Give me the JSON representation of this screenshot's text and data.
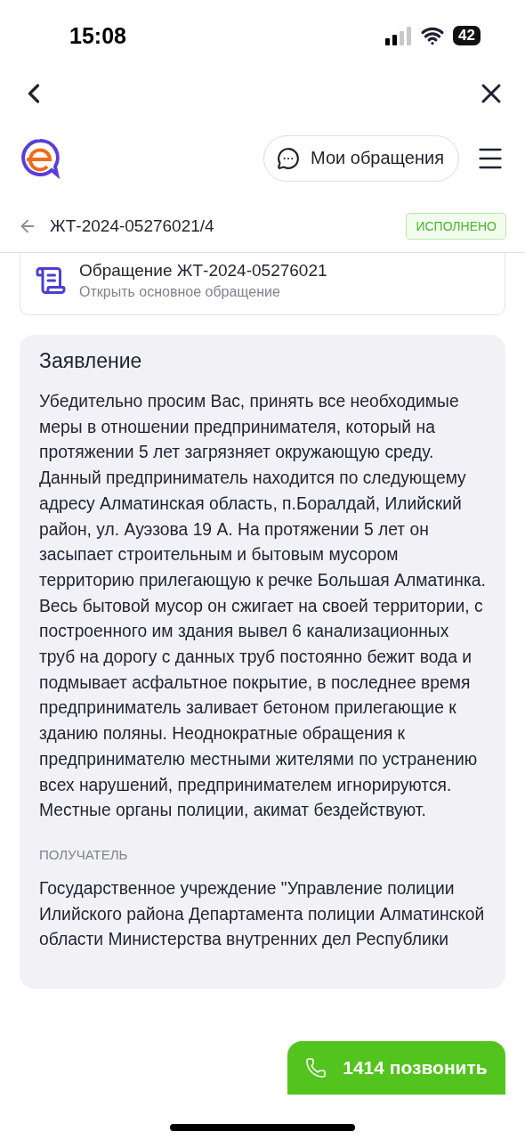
{
  "status_bar": {
    "time": "15:08",
    "battery": "42"
  },
  "header": {
    "my_requests": "Мои обращения"
  },
  "title_row": {
    "number": "ЖТ-2024-05276021/4",
    "status": "ИСПОЛНЕНО"
  },
  "parent_link": {
    "title": "Обращение ЖТ-2024-05276021",
    "subtitle": "Открыть основное обращение"
  },
  "statement": {
    "title": "Заявление",
    "text": "Убедительно просим Вас, принять все необходимые меры в отношении предпринимателя, который на протяжении 5 лет загрязняет окружающую среду. Данный предприниматель находится по следующему адресу Алматинская область, п.Боралдай, Илийский район, ул. Ауэзова 19 А. На протяжении 5 лет он засыпает строительным и бытовым мусором территорию прилегающую к речке Большая Алматинка. Весь бытовой мусор он сжигает на своей территории, с построенного им здания вывел 6 канализационных труб на дорогу с данных труб постоянно бежит вода и подмывает асфальтное покрытие, в последнее время предприниматель заливает бетоном прилегающие к зданию поляны. Неоднократные обращения к предпринимателю местными жителями по устранению всех нарушений, предпринимателем игнорируются. Местные органы полиции, акимат бездействуют.",
    "recipient_label": "ПОЛУЧАТЕЛЬ",
    "recipient": "Государственное учреждение \"Управление полиции Илийского района Департамента полиции Алматинской области Министерства внутренних дел Республики"
  },
  "call_button": {
    "label": "1414 позвонить"
  }
}
